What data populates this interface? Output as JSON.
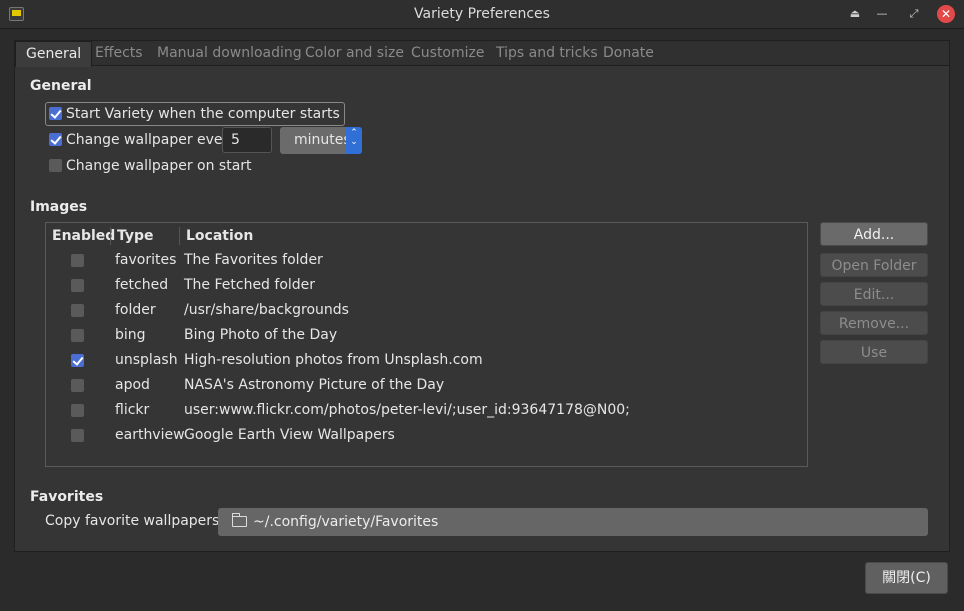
{
  "window": {
    "title": "Variety Preferences"
  },
  "tabs": [
    "General",
    "Effects",
    "Manual downloading",
    "Color and size",
    "Customize",
    "Tips and tricks",
    "Donate"
  ],
  "general": {
    "section_title": "General",
    "start_on_boot": {
      "label": "Start Variety when the computer starts",
      "checked": true
    },
    "change_every": {
      "label": "Change wallpaper every",
      "checked": true,
      "value": "5",
      "unit": "minutes"
    },
    "change_on_start": {
      "label": "Change wallpaper on start",
      "checked": false
    }
  },
  "images": {
    "section_title": "Images",
    "columns": [
      "Enabled",
      "Type",
      "Location"
    ],
    "rows": [
      {
        "enabled": false,
        "type": "favorites",
        "location": "The Favorites folder"
      },
      {
        "enabled": false,
        "type": "fetched",
        "location": "The Fetched folder"
      },
      {
        "enabled": false,
        "type": "folder",
        "location": "/usr/share/backgrounds"
      },
      {
        "enabled": false,
        "type": "bing",
        "location": "Bing Photo of the Day"
      },
      {
        "enabled": true,
        "type": "unsplash",
        "location": "High-resolution photos from Unsplash.com"
      },
      {
        "enabled": false,
        "type": "apod",
        "location": "NASA's Astronomy Picture of the Day"
      },
      {
        "enabled": false,
        "type": "flickr",
        "location": "user:www.flickr.com/photos/peter-levi/;user_id:93647178@N00;"
      },
      {
        "enabled": false,
        "type": "earthview",
        "location": "Google Earth View Wallpapers"
      }
    ],
    "buttons": {
      "add": "Add...",
      "open_folder": "Open Folder",
      "edit": "Edit...",
      "remove": "Remove...",
      "use": "Use"
    }
  },
  "favorites": {
    "section_title": "Favorites",
    "label": "Copy favorite wallpapers to",
    "path": "~/.config/variety/Favorites"
  },
  "footer": {
    "close_label": "關閉(C)"
  }
}
